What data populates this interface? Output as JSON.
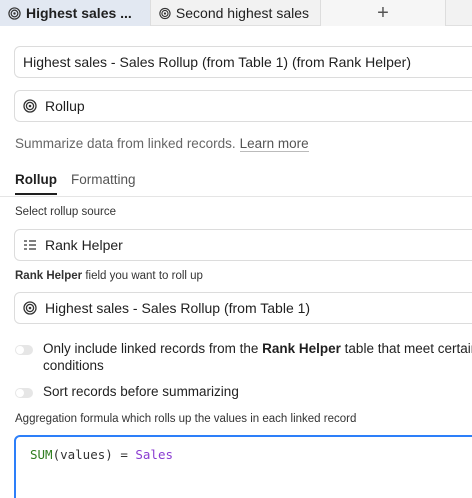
{
  "tabs": [
    {
      "label": "Highest sales ...",
      "icon": "rollup-icon",
      "active": true
    },
    {
      "label": "Second highest sales ...",
      "icon": "rollup-icon",
      "active": false
    }
  ],
  "add_tab_label": "+",
  "field_name_value": "Highest sales - Sales Rollup (from Table 1) (from Rank Helper)",
  "field_type": {
    "label": "Rollup",
    "icon": "rollup-icon"
  },
  "description": {
    "text": "Summarize data from linked records.",
    "link": "Learn more"
  },
  "subtabs": [
    "Rollup",
    "Formatting"
  ],
  "rollup_source": {
    "label": "Select rollup source",
    "value": "Rank Helper",
    "icon": "linked-list-icon"
  },
  "rollup_field": {
    "label_bold": "Rank Helper",
    "label_rest": "field you want to roll up",
    "value": "Highest sales - Sales Rollup (from Table 1)",
    "icon": "rollup-icon"
  },
  "filter_toggle": {
    "text_before": "Only include linked records from the",
    "text_bold": "Rank Helper",
    "text_after": "table that meet certain conditions",
    "on": false
  },
  "sort_toggle": {
    "text": "Sort records before summarizing",
    "on": false
  },
  "aggregation": {
    "label": "Aggregation formula which rolls up the values in each linked record",
    "fn": "SUM",
    "arg": "(values)",
    "op": " = ",
    "field": "Sales"
  },
  "colors": {
    "accent": "#2d7ff9",
    "formula_fn": "#2f7d1f",
    "formula_field": "#8a3bd1",
    "active_tab": "#e2e8f2"
  }
}
